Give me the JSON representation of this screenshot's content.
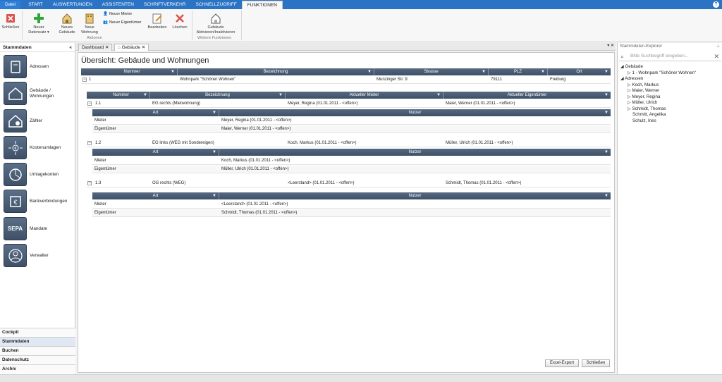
{
  "menu": {
    "file": "Datei",
    "tabs": [
      "START",
      "AUSWERTUNGEN",
      "ASSISTENTEN",
      "SCHRIFTVERKEHR",
      "SCHNELLZUGRIFF",
      "FUNKTIONEN"
    ]
  },
  "ribbon": {
    "close": "Schließen",
    "new_record": "Neuer Datensatz ▾",
    "new_building": "Neues Gebäude",
    "new_flat": "Neue Wohnung",
    "new_tenant": "Neuer Mieter",
    "new_owner": "Neuer Eigentümer",
    "edit": "Bearbeiten",
    "delete": "Löschen",
    "group_actions": "Aktionen",
    "toggle_building": "Gebäude Aktivieren/Inaktivieren",
    "group_more": "Weitere Funktionen"
  },
  "left": {
    "title": "Stammdaten",
    "items": [
      "Adressen",
      "Gebäude / Wohnungen",
      "Zähler",
      "Kostenumlagen",
      "Umlagekonten",
      "Bankverbindungen",
      "Mandate",
      "Verwalter"
    ],
    "bottom": [
      "Cockpit",
      "Stammdaten",
      "Buchen",
      "Datenschutz",
      "Archiv"
    ]
  },
  "doctabs": [
    "Dashboard",
    "Gebäude"
  ],
  "content": {
    "title": "Übersicht: Gebäude und Wohnungen",
    "main_headers": [
      "Nummer",
      "Bezeichnung",
      "Strasse",
      "PLZ",
      "Ort"
    ],
    "building": {
      "nummer": "1",
      "bezeichnung": "Wohnpark \"Schöner Wohnen\"",
      "strasse": "Munzinger Str. 9",
      "plz": "79111",
      "ort": "Freiburg"
    },
    "flat_headers": [
      "Nummer",
      "Bezeichnung",
      "Aktueller Mieter",
      "Aktueller Eigentümer"
    ],
    "sub_headers": [
      "Art",
      "Nutzer"
    ],
    "flats": [
      {
        "nummer": "1.1",
        "bezeichnung": "EG rechts (Mietwohnung)",
        "mieter": "Meyer, Regina (01.01.2011 - <offen>)",
        "eigentuemer": "Maier, Werner (01.01.2011 - <offen>)",
        "rows": [
          {
            "art": "Mieter",
            "nutzer": "Meyer, Regina (01.01.2011 - <offen>)"
          },
          {
            "art": "Eigentümer",
            "nutzer": "Maier, Werner (01.01.2011 - <offen>)"
          }
        ]
      },
      {
        "nummer": "1.2",
        "bezeichnung": "EG links (WEG mit Sondereigen)",
        "mieter": "Koch, Markus (01.01.2011 - <offen>)",
        "eigentuemer": "Müller, Ulrich (01.01.2011 - <offen>)",
        "rows": [
          {
            "art": "Mieter",
            "nutzer": "Koch, Markus (01.01.2011 - <offen>)"
          },
          {
            "art": "Eigentümer",
            "nutzer": "Müller, Ulrich (01.01.2011 - <offen>)"
          }
        ]
      },
      {
        "nummer": "1.3",
        "bezeichnung": "OG rechts (WEG)",
        "mieter": "<Leerstand> (01.01.2011 - <offen>)",
        "eigentuemer": "Schmidt, Thomas (01.01.2011 - <offen>)",
        "rows": [
          {
            "art": "Mieter",
            "nutzer": "<Leerstand> (01.01.2011 - <offen>)"
          },
          {
            "art": "Eigentümer",
            "nutzer": "Schmidt, Thomas (01.01.2011 - <offen>)"
          }
        ]
      }
    ],
    "excel": "Excel-Export",
    "close": "Schließen"
  },
  "right": {
    "title": "Stammdaten-Explorer",
    "search_placeholder": "Bitte Suchbegriff eingeben...",
    "tree": [
      "Gebäude",
      "1 - Wohnpark \"Schöner Wohnen\"",
      "Adressen",
      "Koch, Markus",
      "Maier, Werner",
      "Meyer, Regina",
      "Müller, Ulrich",
      "Schmidt, Thomas",
      "Schmitt, Angelika",
      "Schulz, Ines"
    ]
  }
}
